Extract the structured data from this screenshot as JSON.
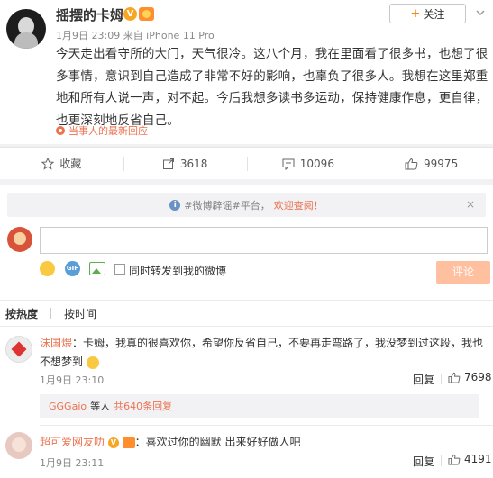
{
  "post": {
    "username": "摇摆的卡姆",
    "verified_badge": "V",
    "meta": "1月9日 23:09 来自 iPhone 11 Pro",
    "follow_label": "关注",
    "text": "今天走出看守所的大门，天气很冷。这八个月，我在里面看了很多书，也想了很多事情，意识到自己造成了非常不好的影响，也辜负了很多人。我想在这里郑重地和所有人说一声，对不起。今后我想多读书多运动，保持健康作息，更自律，也更深刻地反省自己。",
    "reply_note": "当事人的最新回应"
  },
  "actions": {
    "favorite_label": "收藏",
    "repost_count": "3618",
    "comment_count": "10096",
    "like_count": "99975"
  },
  "comments_area": {
    "tip_prefix": "#微博辟谣#平台，",
    "tip_link": "欢迎查阅！",
    "tip_close": "×",
    "input_value": "",
    "gif_label": "GIF",
    "repost_label": "同时转发到我的微博",
    "submit_label": "评论",
    "sort_hot": "按热度",
    "sort_time": "按时间"
  },
  "comments": [
    {
      "nick": "沫国煨",
      "text": "：卡姆，我真的很喜欢你，希望你反省自己，不要再走弯路了，我没梦到过这段，我也不想梦到",
      "time": "1月9日 23:10",
      "reply_label": "回复",
      "likes": "7698",
      "sub_nick": "GGGaio",
      "sub_text": "等人",
      "sub_count": "共640条回复"
    },
    {
      "nick": "超可爱网友叻",
      "text": "：喜欢过你的幽默 出来好好做人吧",
      "time": "1月9日 23:11",
      "reply_label": "回复",
      "likes": "4191"
    }
  ],
  "icons": {
    "favorite": "star-icon",
    "repost": "share-arrow-icon",
    "comment": "speech-bubble-icon",
    "like": "thumbs-up-icon",
    "emoji": "smiley-icon",
    "gif": "gif-icon",
    "picture": "picture-icon",
    "tip": "info-icon",
    "reply_note": "location-dot-icon"
  },
  "colors": {
    "accent_orange": "#ff8200",
    "link_orange": "#eb7350",
    "submit_disabled": "#ffc09f",
    "tip_bg": "#f2f2f5"
  }
}
